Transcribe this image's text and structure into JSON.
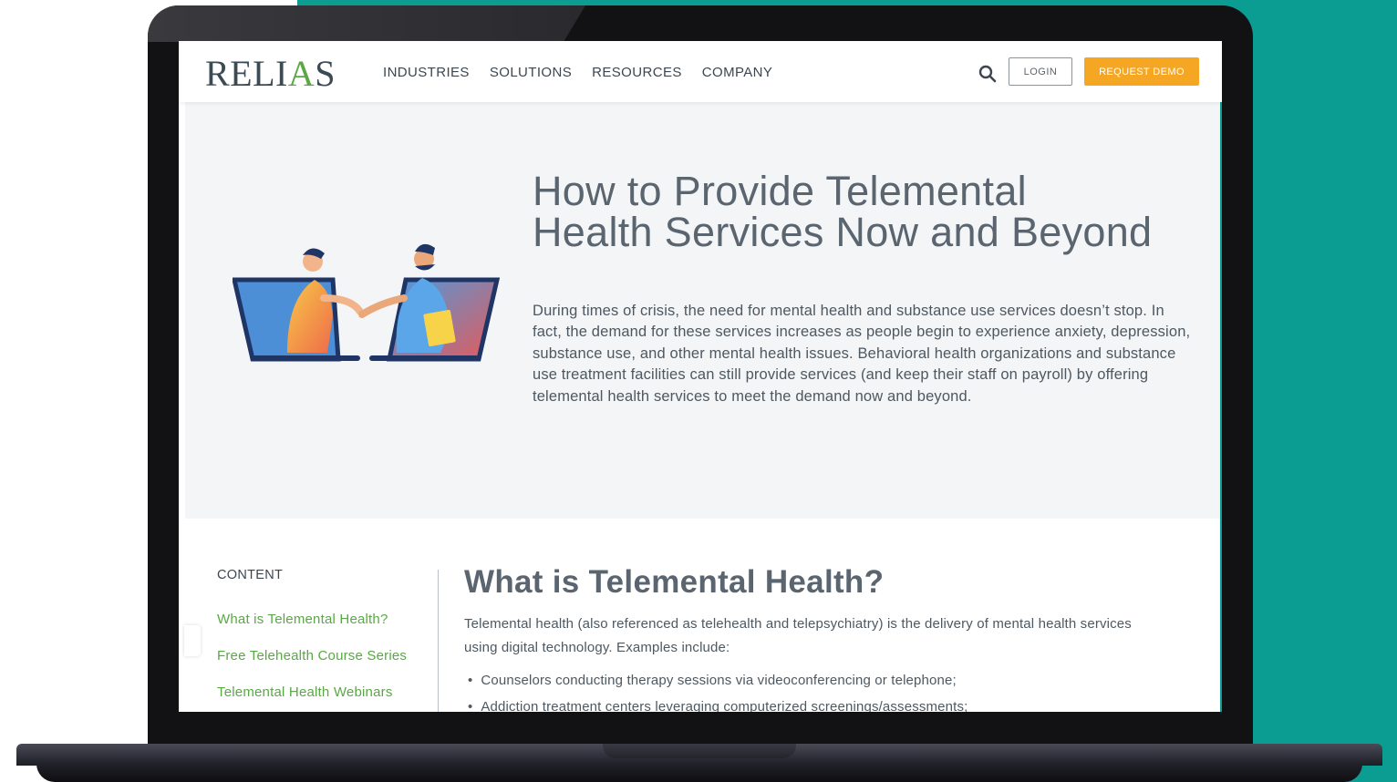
{
  "brand": {
    "logo_text_left": "RELI",
    "logo_text_accent": "A",
    "logo_text_right": "S",
    "accent_color": "#5aa845",
    "bg_teal": "#0b9c92"
  },
  "header": {
    "nav": [
      "INDUSTRIES",
      "SOLUTIONS",
      "RESOURCES",
      "COMPANY"
    ],
    "search_icon": "search-icon",
    "login_label": "LOGIN",
    "demo_label": "REQUEST DEMO",
    "demo_color": "#f5a623"
  },
  "hero": {
    "title": "How to Provide Telemental Health Services Now and Beyond",
    "text": "During times of crisis, the need for mental health and substance use services doesn’t stop. In fact, the demand for these services increases as people begin to experience anxiety, depression, substance use, and other mental health issues. Behavioral health organizations and substance use treatment facilities can still provide services (and keep their staff on payroll) by offering telemental health services to meet the demand now and beyond."
  },
  "sidebar": {
    "label": "CONTENT",
    "links": [
      "What is Telemental Health?",
      "Free Telehealth Course Series",
      "Telemental Health Webinars"
    ]
  },
  "main": {
    "title": "What is Telemental Health?",
    "intro": "Telemental health (also referenced as telehealth and telepsychiatry) is the delivery of mental health services using digital technology. Examples include:",
    "bullets": [
      "Counselors conducting therapy sessions via videoconferencing or telephone;",
      "Addiction treatment centers leveraging computerized screenings/assessments;"
    ]
  }
}
